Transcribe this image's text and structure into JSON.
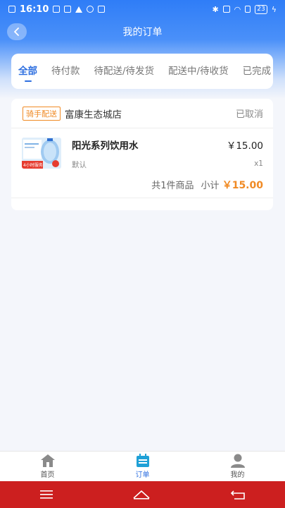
{
  "status_bar": {
    "time": "16:10",
    "battery": "23"
  },
  "header": {
    "title": "我的订单"
  },
  "tabs": [
    {
      "label": "全部",
      "active": true
    },
    {
      "label": "待付款",
      "active": false
    },
    {
      "label": "待配送/待发货",
      "active": false
    },
    {
      "label": "配送中/待收货",
      "active": false
    },
    {
      "label": "已完成",
      "active": false
    }
  ],
  "order": {
    "delivery_badge": "骑手配送",
    "store_name": "富康生态城店",
    "status": "已取消",
    "item": {
      "name": "阳光系列饮用水",
      "spec": "默认",
      "price": "￥15.00",
      "quantity": "x1",
      "image_badge": "4小时服务"
    },
    "summary_count": "共1件商品",
    "subtotal_label": "小计",
    "subtotal_amount": "￥15.00"
  },
  "tabbar": [
    {
      "label": "首页",
      "icon": "home-icon",
      "active": false
    },
    {
      "label": "订单",
      "icon": "orders-icon",
      "active": true
    },
    {
      "label": "我的",
      "icon": "profile-icon",
      "active": false
    }
  ],
  "colors": {
    "primary": "#2e6fe0",
    "accent": "#f08a24",
    "system_nav": "#cc1f1f"
  }
}
